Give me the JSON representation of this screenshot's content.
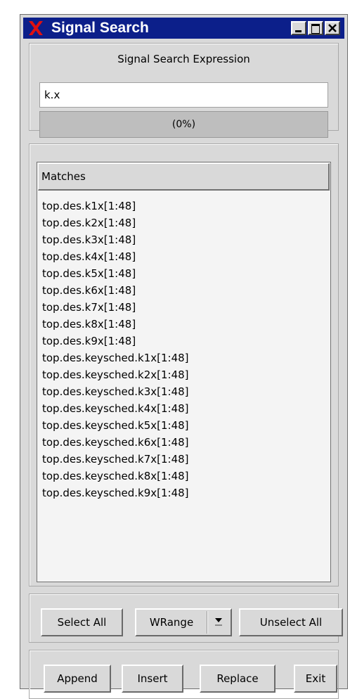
{
  "window": {
    "title": "Signal Search"
  },
  "search": {
    "label": "Signal Search Expression",
    "value": "k.x",
    "progress_text": "(0%)"
  },
  "matches": {
    "header": "Matches",
    "items": [
      "top.des.k1x[1:48]",
      "top.des.k2x[1:48]",
      "top.des.k3x[1:48]",
      "top.des.k4x[1:48]",
      "top.des.k5x[1:48]",
      "top.des.k6x[1:48]",
      "top.des.k7x[1:48]",
      "top.des.k8x[1:48]",
      "top.des.k9x[1:48]",
      "top.des.keysched.k1x[1:48]",
      "top.des.keysched.k2x[1:48]",
      "top.des.keysched.k3x[1:48]",
      "top.des.keysched.k4x[1:48]",
      "top.des.keysched.k5x[1:48]",
      "top.des.keysched.k6x[1:48]",
      "top.des.keysched.k7x[1:48]",
      "top.des.keysched.k8x[1:48]",
      "top.des.keysched.k9x[1:48]"
    ]
  },
  "selection": {
    "select_all": "Select All",
    "wrange": "WRange",
    "unselect_all": "Unselect All"
  },
  "actions": {
    "append": "Append",
    "insert": "Insert",
    "replace": "Replace",
    "exit": "Exit"
  },
  "colors": {
    "titlebar": "#0c1f8a",
    "app_icon": "#e01010",
    "window_bg": "#d9d9d9"
  },
  "icons": {
    "app": "x-logo-icon",
    "minimize": "minimize-icon",
    "maximize": "maximize-icon",
    "close": "close-icon",
    "dropdown": "chevron-down-icon"
  }
}
